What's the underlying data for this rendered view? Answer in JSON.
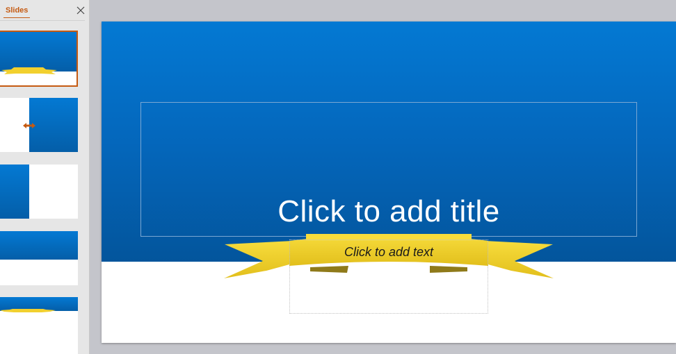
{
  "slides_pane": {
    "tab_label": "Slides",
    "close_icon": "close-icon",
    "thumbnails": [
      {
        "index": 1,
        "selected": true,
        "layout": "title-ribbon"
      },
      {
        "index": 2,
        "selected": false,
        "layout": "right-blue-with-arrow"
      },
      {
        "index": 3,
        "selected": false,
        "layout": "left-blue"
      },
      {
        "index": 4,
        "selected": false,
        "layout": "top-blue"
      },
      {
        "index": 5,
        "selected": false,
        "layout": "top-blue-ribbon"
      }
    ]
  },
  "slide": {
    "title_placeholder": "Click to add title",
    "subtitle_placeholder": "Click to add text"
  },
  "colors": {
    "accent": "#c55a11",
    "band_top": "#0479d3",
    "band_bottom": "#03559c",
    "ribbon": "#f2d02e",
    "canvas_bg": "#c4c5cb"
  }
}
